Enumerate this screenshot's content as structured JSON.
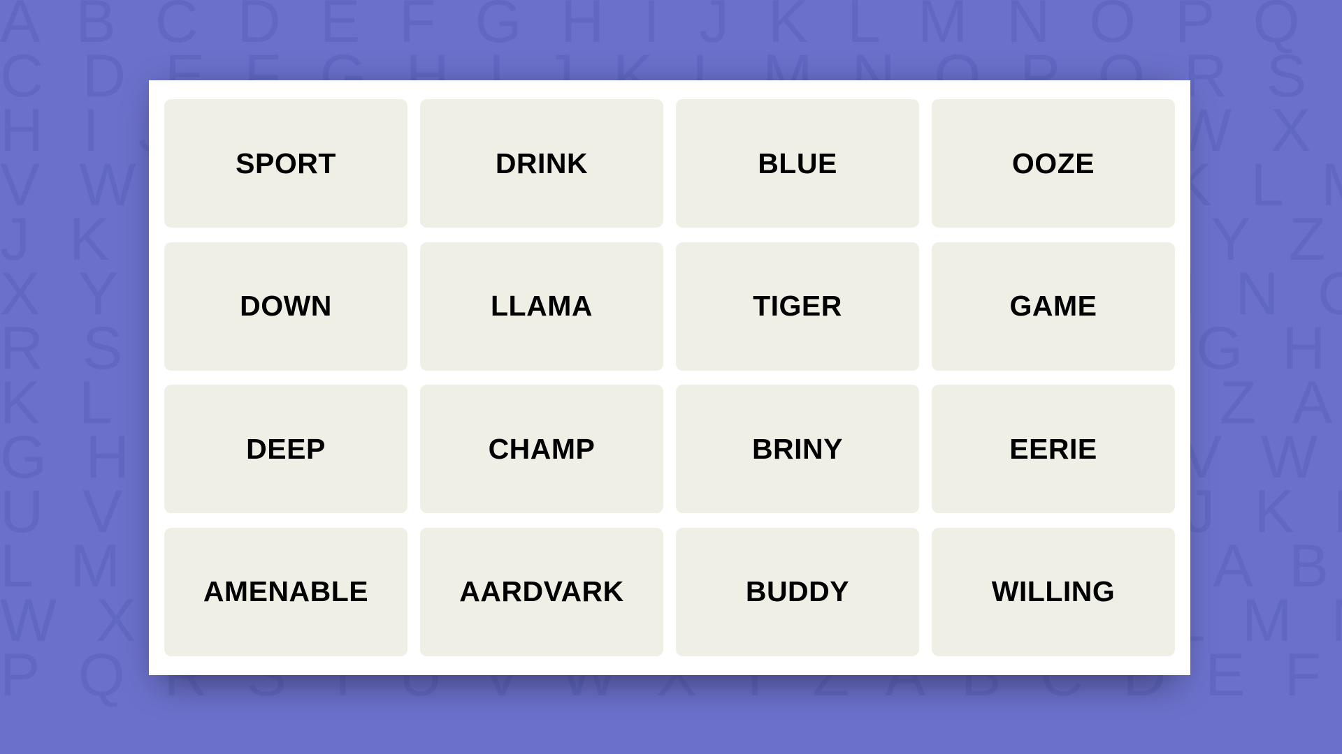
{
  "theme": {
    "background_color": "#6b71cb",
    "pattern_letter_color": "#6168c2",
    "board_color": "#ffffff",
    "tile_color": "#efefe6",
    "tile_text_color": "#000000",
    "shadow_color": "#2b2b52"
  },
  "background_pattern": {
    "type": "repeating-alphabet",
    "rows": [
      "A B C D E F G H I J K L M N O P Q R S T U V W X Y Z A B C D E F",
      "C D E F G H I J K L M N O P Q R S T U V W X Y Z A B C D E F G H",
      "H I J K L M N O P Q R S T U V W X Y Z A B C D E F G H I J K L M",
      "V W X Y Z A B C D E F G H I J K L M N O P Q R S T U V W X Y Z A",
      "J K L M N O P Q R S T U V W X Y Z A B C D E F G H I J K L M N O",
      "X Y Z A B C D E F G H I J K L M N O P Q R S T U V W X Y Z A B C",
      "R S T U V W X Y Z A B C D E F G H I J K L M N O P Q R S T U V W",
      "K L M N O P Q R S T U V W X Y Z A B C D E F G H I J K L M N O P",
      "G H I J K L M N O P Q R S T U V W X Y Z A B C D E F G H I J K L",
      "U V W X Y Z A B C D E F G H I J K L M N O P Q R S T U V W X Y Z",
      "L M N O P Q R S T U V W X Y Z A B C D E F G H I J K L M N O P Q",
      "W X Y Z A B C D E F G H I J K L M N O P Q R S T U V W X Y Z A B",
      "P Q R S T U V W X Y Z A B C D E F G H I J K L M N O P Q R S T U"
    ]
  },
  "board": {
    "grid": {
      "columns": 4,
      "rows": 4
    },
    "tiles": [
      [
        {
          "label": "SPORT"
        },
        {
          "label": "DRINK"
        },
        {
          "label": "BLUE"
        },
        {
          "label": "OOZE"
        }
      ],
      [
        {
          "label": "DOWN"
        },
        {
          "label": "LLAMA"
        },
        {
          "label": "TIGER"
        },
        {
          "label": "GAME"
        }
      ],
      [
        {
          "label": "DEEP"
        },
        {
          "label": "CHAMP"
        },
        {
          "label": "BRINY"
        },
        {
          "label": "EERIE"
        }
      ],
      [
        {
          "label": "AMENABLE"
        },
        {
          "label": "AARDVARK"
        },
        {
          "label": "BUDDY"
        },
        {
          "label": "WILLING"
        }
      ]
    ]
  }
}
